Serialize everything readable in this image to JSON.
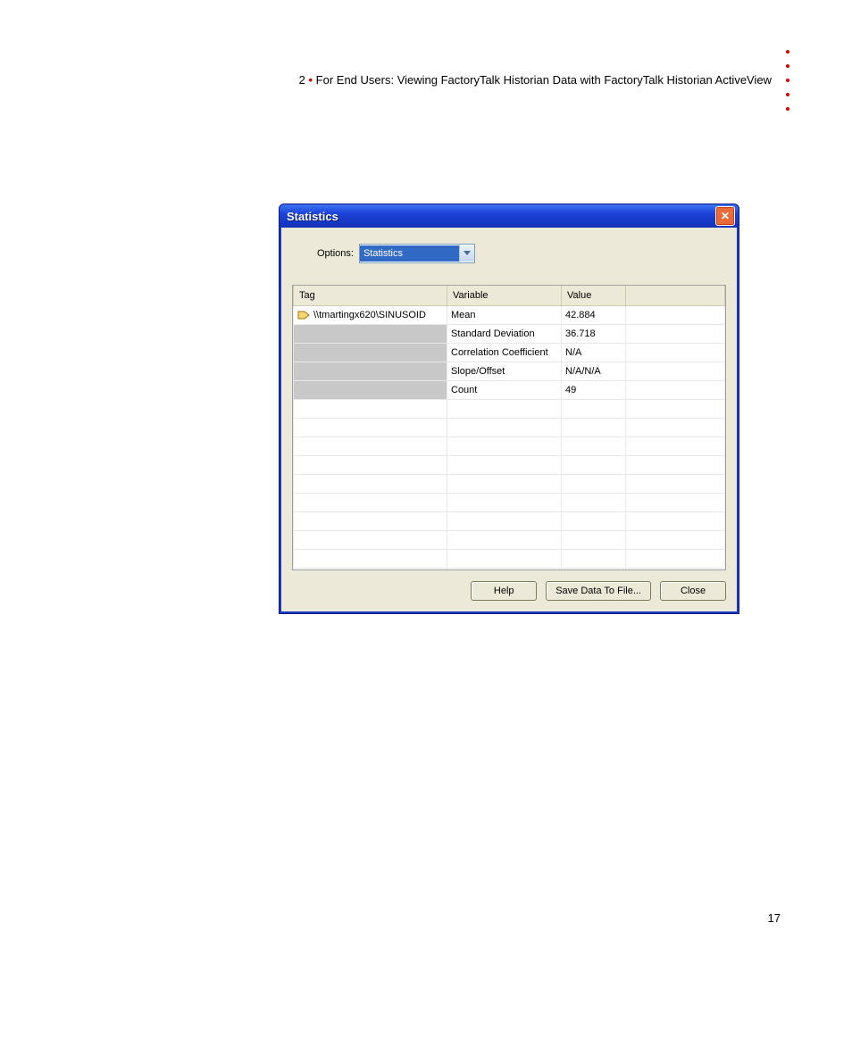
{
  "document": {
    "chapter_number": "2",
    "dot": "•",
    "chapter_title": "For End Users: Viewing FactoryTalk Historian Data with FactoryTalk Historian ActiveView",
    "page_number": "17"
  },
  "dialog": {
    "title": "Statistics",
    "options_label": "Options:",
    "options_selected": "Statistics",
    "columns": {
      "tag": "Tag",
      "variable": "Variable",
      "value": "Value"
    },
    "tag_name": "\\\\tmartingx620\\SINUSOID",
    "rows": [
      {
        "variable": "Mean",
        "value": "42.884"
      },
      {
        "variable": "Standard Deviation",
        "value": "36.718"
      },
      {
        "variable": "Correlation Coefficient",
        "value": "N/A"
      },
      {
        "variable": "Slope/Offset",
        "value": "N/A/N/A"
      },
      {
        "variable": "Count",
        "value": "49"
      }
    ],
    "buttons": {
      "help": "Help",
      "save": "Save Data To File...",
      "close": "Close"
    }
  }
}
